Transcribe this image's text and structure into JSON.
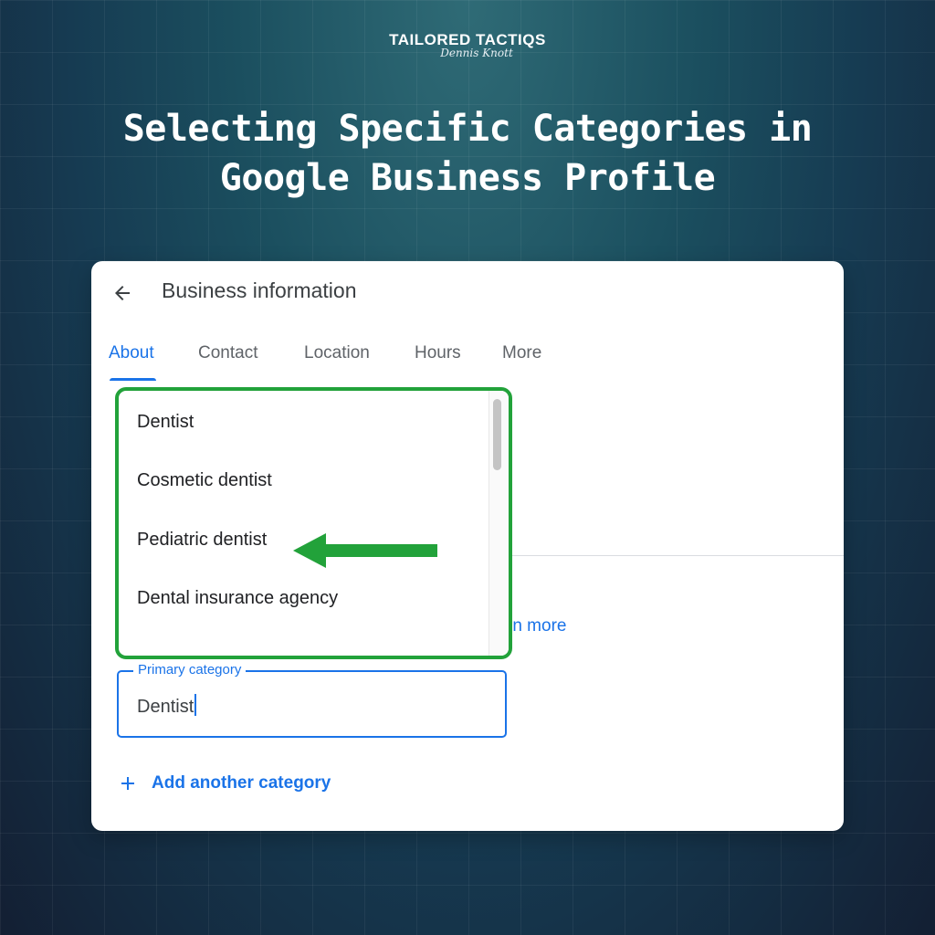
{
  "brand": {
    "name": "TAILORED TACTIQS",
    "signature": "Dennis Knott"
  },
  "headline": {
    "line1": "Selecting Specific Categories in",
    "line2": "Google Business Profile"
  },
  "panel": {
    "title": "Business information",
    "back_icon": "arrow-back-icon",
    "tabs": [
      {
        "label": "About",
        "active": true
      },
      {
        "label": "Contact",
        "active": false
      },
      {
        "label": "Location",
        "active": false
      },
      {
        "label": "Hours",
        "active": false
      },
      {
        "label": "More",
        "active": false
      }
    ],
    "suggestions": [
      "Dentist",
      "Cosmetic dentist",
      "Pediatric dentist",
      "Dental insurance agency"
    ],
    "highlight_color": "#22a23a",
    "pointer_arrow": "left-arrow-icon",
    "learn_more_partial": "rn more",
    "primary_category": {
      "label": "Primary category",
      "value": "Dentist"
    },
    "add_category": {
      "icon": "plus-icon",
      "label": "Add another category"
    },
    "accent_color": "#1a73e8"
  }
}
